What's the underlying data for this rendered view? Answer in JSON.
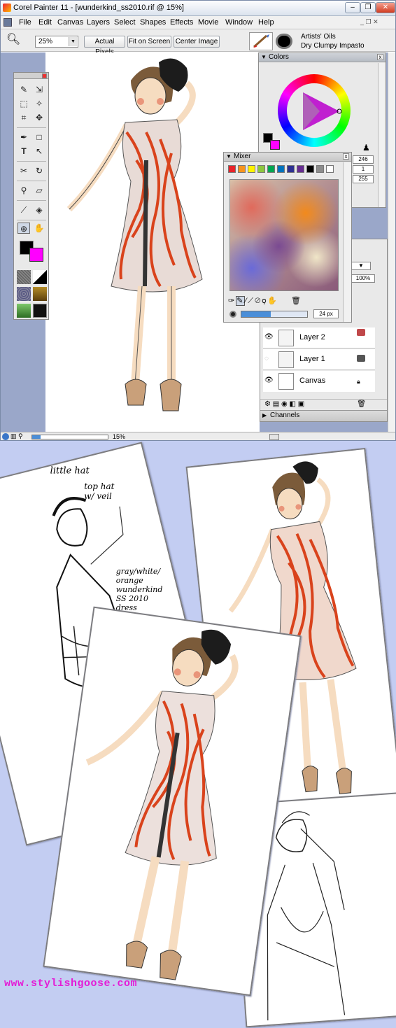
{
  "window": {
    "title": "Corel Painter 11 - [wunderkind_ss2010.rif @ 15%]",
    "minimize_glyph": "–",
    "restore_glyph": "❐",
    "close_glyph": "✕"
  },
  "menu": [
    "File",
    "Edit",
    "Canvas",
    "Layers",
    "Select",
    "Shapes",
    "Effects",
    "Movie",
    "Window",
    "Help"
  ],
  "property_bar": {
    "zoom_value": "25%",
    "buttons": [
      "Actual Pixels",
      "Fit on Screen",
      "Center Image"
    ],
    "brush_category": "Artists' Oils",
    "brush_variant": "Dry Clumpy Impasto"
  },
  "colors_panel": {
    "title": "Colors",
    "main_color": "#000000",
    "additional_color": "#ff00ff"
  },
  "mixer_panel": {
    "title": "Mixer",
    "swatches": [
      "#e8242a",
      "#f7941d",
      "#fff200",
      "#8dc63f",
      "#00a651",
      "#0072bc",
      "#2e3192",
      "#662d91",
      "#000000",
      "#8c8c8c",
      "#ffffff"
    ],
    "brush_size": "24 px"
  },
  "layers_panel": {
    "rgb_values": [
      "246",
      "1",
      "255"
    ],
    "opacity": "100%",
    "layers": [
      {
        "name": "Layer 2",
        "visible": true
      },
      {
        "name": "Layer 1",
        "visible": false
      },
      {
        "name": "Canvas",
        "visible": true
      }
    ],
    "channels_label": "Channels"
  },
  "status_bar": {
    "zoom": "15%"
  },
  "sketch_notes": [
    "little hat",
    "top hat w/ veil",
    "gray/white/ orange wunderkind SS 2010 dress"
  ],
  "footer": {
    "url": "www.stylishgoose.com"
  },
  "colors": {
    "dress_orange": "#d9431c",
    "skin": "#f6dcc0",
    "hair": "#7b5b3a",
    "accent": "#e41cd6",
    "lower_bg": "#c3cdf2",
    "canvas_bg": "#9aa7c9"
  }
}
